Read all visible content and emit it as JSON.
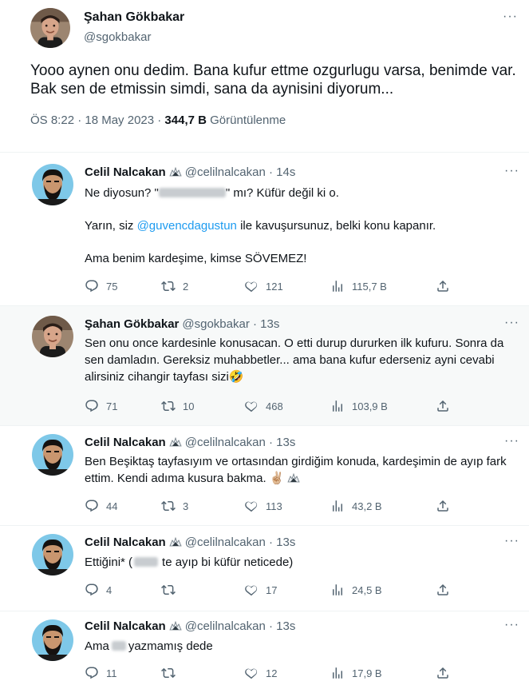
{
  "main_tweet": {
    "name": "Şahan Gökbakar",
    "handle": "@sgokbakar",
    "text": "Yooo aynen onu dedim. Bana kufur ettme ozgurlugu varsa, benimde var. Bak sen de etmissin simdi, sana da aynisini diyorum...",
    "time": "ÖS 8:22 · 18 May 2023 · ",
    "views": "344,7 B",
    "views_label": " Görüntülenme",
    "more": "···"
  },
  "replies": [
    {
      "name": "Celil Nalcakan",
      "handle": "@celilnalcakan · 14s",
      "line1_a": "Ne diyosun? \"",
      "line1_b": "\" mı? Küfür değil ki o.",
      "line2_a": "Yarın, siz ",
      "line2_mention": "@guvencdagustun",
      "line2_b": " ile kavuşursunuz, belki konu kapanır.",
      "line3": "Ama benim kardeşime, kimse SÖVEMEZ!",
      "replies": "75",
      "retweets": "2",
      "likes": "121",
      "views": "115,7 B",
      "more": "···"
    },
    {
      "name": "Şahan Gökbakar",
      "handle": "@sgokbakar · 13s",
      "text": "Sen onu once kardesinle konusacan. O etti durup dururken ilk kufuru. Sonra da sen damladın. Gereksiz muhabbetler... ama bana kufur ederseniz ayni cevabi alirsiniz cihangir tayfası sizi🤣",
      "replies": "71",
      "retweets": "10",
      "likes": "468",
      "views": "103,9 B",
      "more": "···"
    },
    {
      "name": "Celil Nalcakan",
      "handle": "@celilnalcakan · 13s",
      "text": "Ben Beşiktaş tayfasıyım ve ortasından girdiğim konuda, kardeşimin de ayıp fark ettim. Kendi adıma kusura bakma. ✌🏼",
      "replies": "44",
      "retweets": "3",
      "likes": "113",
      "views": "43,2 B",
      "more": "···"
    },
    {
      "name": "Celil Nalcakan",
      "handle": "@celilnalcakan · 13s",
      "text_a": "Ettiğini* (",
      "text_b": "te ayıp bi küfür neticede)",
      "replies": "4",
      "retweets": "",
      "likes": "17",
      "views": "24,5 B",
      "more": "···"
    },
    {
      "name": "Celil Nalcakan",
      "handle": "@celilnalcakan · 13s",
      "text_a": "Ama",
      "text_b": "yazmamış dede",
      "replies": "11",
      "retweets": "",
      "likes": "12",
      "views": "17,9 B",
      "more": "···"
    }
  ],
  "icons": {
    "reply": "reply-icon",
    "retweet": "retweet-icon",
    "like": "like-icon",
    "views": "views-icon",
    "share": "share-icon",
    "verified_emoji": "eagle-emoji-icon"
  },
  "colors": {
    "link": "#1d9bf0",
    "secondary_text": "#536471",
    "primary_text": "#0f1419",
    "highlight_bg": "#f7f9f9"
  }
}
